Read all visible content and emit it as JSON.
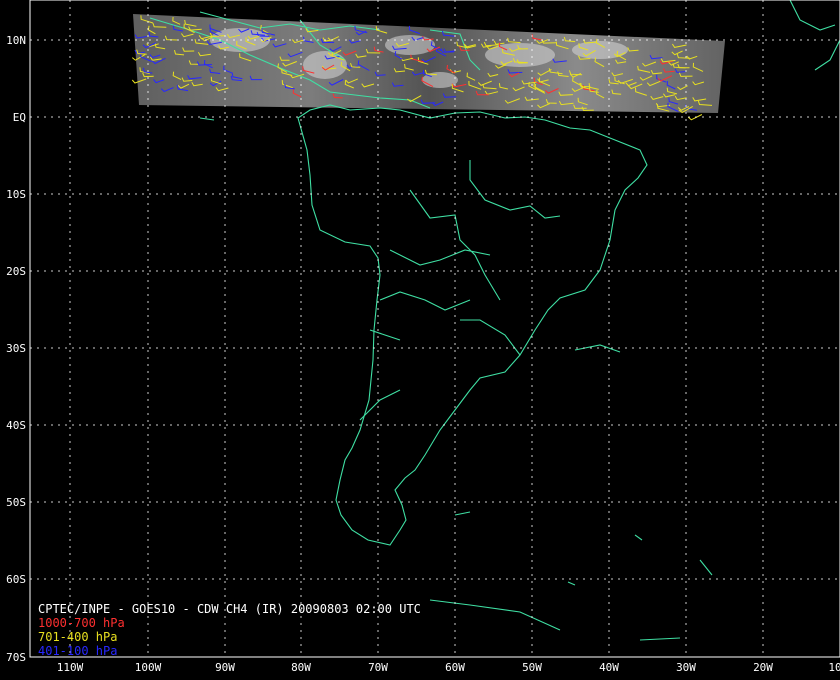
{
  "map": {
    "lat_labels": [
      "10N",
      "EQ",
      "10S",
      "20S",
      "30S",
      "40S",
      "50S",
      "60S",
      "70S"
    ],
    "lon_labels": [
      "110W",
      "100W",
      "90W",
      "80W",
      "70W",
      "60W",
      "50W",
      "40W",
      "30W",
      "20W",
      "10"
    ],
    "coast_color": "#3fdfa3",
    "grid_color": "#ffffff"
  },
  "caption": {
    "title": "CPTEC/INPE - GOES10 - CDW CH4 (IR) 20090803 02:00 UTC",
    "legend": [
      {
        "label": "1000-700 hPa",
        "color": "#ff3030"
      },
      {
        "label": "701-400 hPa",
        "color": "#e8e020"
      },
      {
        "label": "401-100 hPa",
        "color": "#2828ff"
      }
    ]
  }
}
